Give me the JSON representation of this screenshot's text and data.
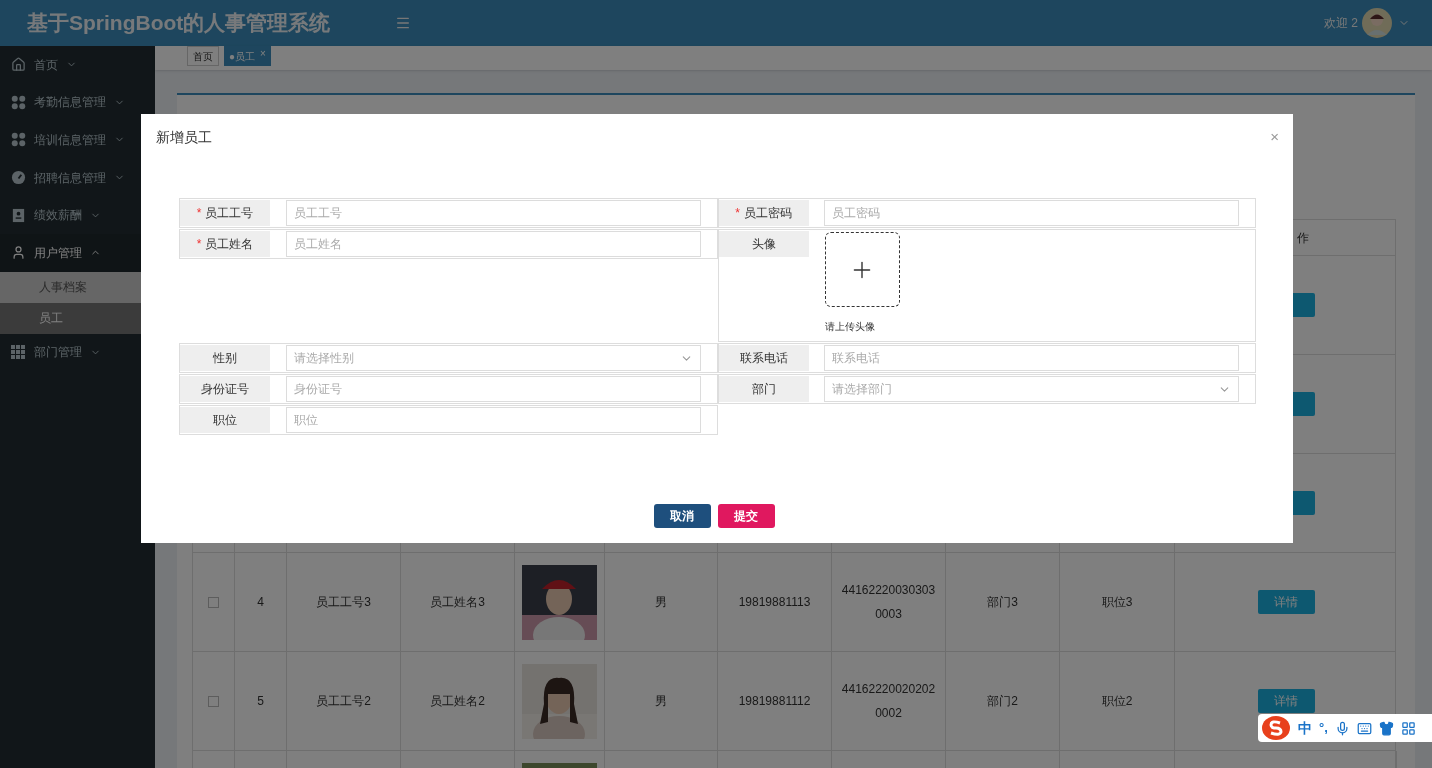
{
  "header": {
    "title": "基于SpringBoot的人事管理系统",
    "welcome": "欢迎 2"
  },
  "sidebar": {
    "items": [
      {
        "label": "首页",
        "expanded": false
      },
      {
        "label": "考勤信息管理",
        "expanded": false
      },
      {
        "label": "培训信息管理",
        "expanded": false
      },
      {
        "label": "招聘信息管理",
        "expanded": false
      },
      {
        "label": "绩效薪酬",
        "expanded": false
      },
      {
        "label": "用户管理",
        "expanded": true,
        "children": [
          {
            "label": "人事档案",
            "selected": false
          },
          {
            "label": "员工",
            "selected": true
          }
        ]
      },
      {
        "label": "部门管理",
        "expanded": false
      }
    ]
  },
  "tabs": [
    {
      "label": "首页",
      "selected": false
    },
    {
      "label": "●员工",
      "selected": true,
      "close": "×"
    }
  ],
  "table": {
    "header_visible": "作",
    "rows": [
      {
        "kind": "covered"
      },
      {
        "kind": "covered"
      },
      {
        "kind": "covered"
      },
      {
        "kind": "data",
        "checked": false,
        "index": "4",
        "code": "员工工号3",
        "name": "员工姓名3",
        "gender": "男",
        "phone": "19819881113",
        "id_card": "441622200303030003",
        "dept": "部门3",
        "position": "职位3",
        "action": "详情"
      },
      {
        "kind": "data",
        "checked": false,
        "index": "5",
        "code": "员工工号2",
        "name": "员工姓名2",
        "gender": "男",
        "phone": "19819881112",
        "id_card": "441622200202020002",
        "dept": "部门2",
        "position": "职位2",
        "action": "详情"
      },
      {
        "kind": "partial"
      }
    ]
  },
  "dialog": {
    "title": "新增员工",
    "close": "×",
    "rows": [
      [
        {
          "kind": "input",
          "mark": "*",
          "label": "员工工号",
          "placeholder": "员工工号"
        },
        {
          "kind": "input",
          "mark": "*",
          "label": "员工密码",
          "placeholder": "员工密码"
        }
      ],
      [
        {
          "kind": "input",
          "mark": "*",
          "label": "员工姓名",
          "placeholder": "员工姓名"
        },
        {
          "kind": "upload",
          "label": "头像",
          "hint": "请上传头像"
        }
      ],
      [
        {
          "kind": "select",
          "label": "性别",
          "placeholder": "请选择性别"
        },
        {
          "kind": "input",
          "label": "联系电话",
          "placeholder": "联系电话"
        }
      ],
      [
        {
          "kind": "input",
          "label": "身份证号",
          "placeholder": "身份证号"
        },
        {
          "kind": "select",
          "label": "部门",
          "placeholder": "请选择部门"
        }
      ],
      [
        {
          "kind": "input",
          "label": "职位",
          "placeholder": "职位"
        },
        null
      ]
    ],
    "buttons": [
      {
        "label": "取消",
        "kind": "cancel"
      },
      {
        "label": "提交",
        "kind": "submit"
      }
    ]
  },
  "ime": {
    "mode": "中",
    "punct": "°,"
  }
}
